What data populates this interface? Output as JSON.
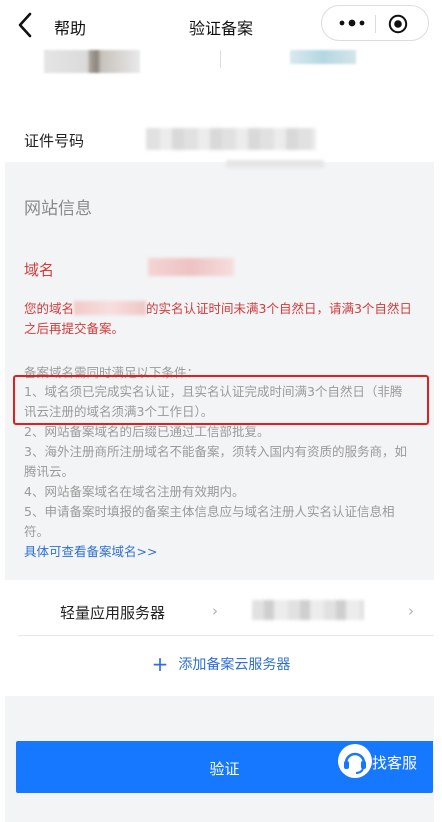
{
  "nav": {
    "help": "帮助",
    "title": "验证备案"
  },
  "id_row": {
    "label": "证件号码"
  },
  "section": {
    "title": "网站信息"
  },
  "domain": {
    "label": "域名"
  },
  "warning": {
    "prefix": "您的域名",
    "suffix": "的实名认证时间未满3个自然日，请满3个自然日之后再提交备案。"
  },
  "conditions": {
    "heading": "备案域名需同时满足以下条件：",
    "items": [
      "1、域名须已完成实名认证，且实名认证完成时间满3个自然日（非腾讯云注册的域名须满3个工作日）。",
      "2、网站备案域名的后缀已通过工信部批复。",
      "3、海外注册商所注册域名不能备案，须转入国内有资质的服务商，如腾讯云。",
      "4、网站备案域名在域名注册有效期内。",
      "5、申请备案时填报的备案主体信息应与域名注册人实名认证信息相符。"
    ],
    "link": "具体可查看备案域名>>"
  },
  "server": {
    "label": "轻量应用服务器",
    "chevron": "›"
  },
  "add_server": {
    "icon": "+",
    "label": "添加备案云服务器"
  },
  "verify": {
    "label": "验证"
  },
  "customer_service": {
    "label": "找客服"
  },
  "colors": {
    "primary": "#1677ff",
    "warning": "#d13b3b",
    "muted": "#9a9a9a",
    "link": "#2f6fd6",
    "highlight_box": "#e02020"
  }
}
